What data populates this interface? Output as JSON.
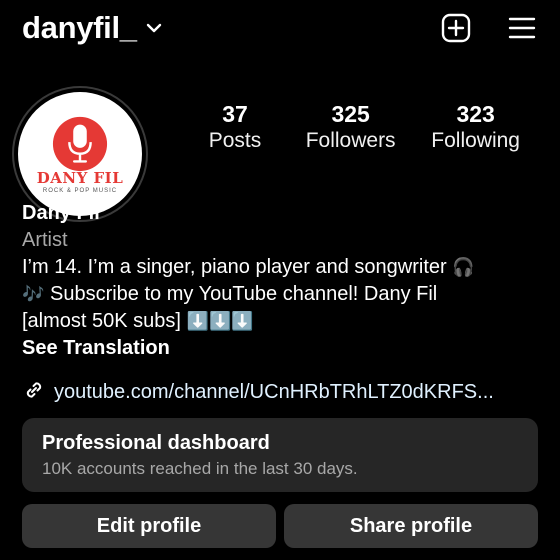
{
  "header": {
    "username": "danyfil_",
    "create_icon": "plus-square-icon",
    "menu_icon": "hamburger-menu-icon"
  },
  "profile": {
    "avatar_icon": "microphone-icon",
    "avatar_brand": "DANY FIL",
    "avatar_tagline": "ROCK & POP MUSIC",
    "avatar_accent": "#e53935"
  },
  "stats": [
    {
      "value": "37",
      "label": "Posts"
    },
    {
      "value": "325",
      "label": "Followers"
    },
    {
      "value": "323",
      "label": "Following"
    }
  ],
  "bio": {
    "name": "Dany Fil",
    "category": "Artist",
    "line1": "I’m 14. I’m a singer, piano player and songwriter",
    "line1_emoji": "🎧",
    "line2_emoji": "🎶",
    "line2": " Subscribe to my YouTube channel! Dany Fil",
    "line3": "[almost 50K subs] ",
    "line3_emoji": "⬇️⬇️⬇️",
    "see_translation": "See Translation"
  },
  "link": {
    "icon": "link-icon",
    "text": "youtube.com/channel/UCnHRbTRhLTZ0dKRFS..."
  },
  "dashboard": {
    "title": "Professional dashboard",
    "subtitle": "10K accounts reached in the last 30 days."
  },
  "actions": {
    "edit_label": "Edit profile",
    "share_label": "Share profile"
  }
}
